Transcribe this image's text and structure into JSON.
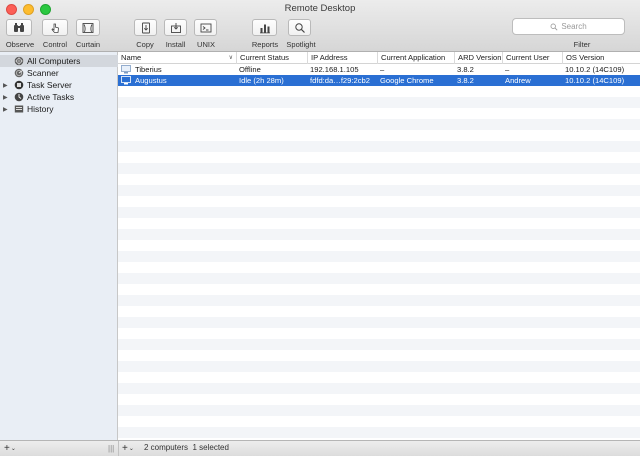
{
  "window": {
    "title": "Remote Desktop"
  },
  "toolbar": {
    "observe_label": "Observe",
    "control_label": "Control",
    "curtain_label": "Curtain",
    "copy_label": "Copy",
    "install_label": "Install",
    "unix_label": "UNIX",
    "reports_label": "Reports",
    "spotlight_label": "Spotlight",
    "filter_label": "Filter",
    "search_placeholder": "Search"
  },
  "sidebar": {
    "items": [
      {
        "label": "All Computers",
        "icon": "all-computers-icon",
        "selected": true
      },
      {
        "label": "Scanner",
        "icon": "scanner-icon",
        "selected": false
      },
      {
        "label": "Task Server",
        "icon": "task-server-icon",
        "selected": false
      },
      {
        "label": "Active Tasks",
        "icon": "active-tasks-icon",
        "selected": false
      },
      {
        "label": "History",
        "icon": "history-icon",
        "selected": false
      }
    ]
  },
  "table": {
    "columns": [
      "Name",
      "Current Status",
      "IP Address",
      "Current Application",
      "ARD Version",
      "Current User",
      "OS Version"
    ],
    "rows": [
      {
        "name": "Tiberius",
        "status": "Offline",
        "ip": "192.168.1.105",
        "app": "–",
        "ard": "3.8.2",
        "user": "–",
        "os": "10.10.2 (14C109)"
      },
      {
        "name": "Augustus",
        "status": "Idle (2h 28m)",
        "ip": "fdfd:da…f29:2cb2",
        "app": "Google Chrome",
        "ard": "3.8.2",
        "user": "Andrew",
        "os": "10.10.2 (14C109)"
      }
    ]
  },
  "status": {
    "summary": "2 computers  1 selected"
  },
  "bottom": {
    "add_left": "+",
    "add_right": "+"
  },
  "colors": {
    "selection": "#2a6fd3",
    "close": "#fc5f57",
    "minimize": "#fdbc2e",
    "maximize": "#2ac840"
  }
}
